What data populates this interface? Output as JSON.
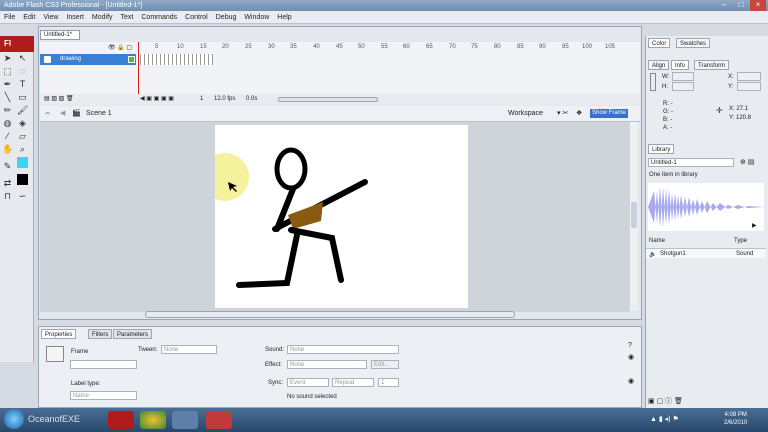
{
  "window": {
    "title": "Adobe Flash CS3 Professional - [Untitled-1*]"
  },
  "menu": [
    "File",
    "Edit",
    "View",
    "Insert",
    "Modify",
    "Text",
    "Commands",
    "Control",
    "Debug",
    "Window",
    "Help"
  ],
  "doc": {
    "tab": "Untitled-1*"
  },
  "timeline": {
    "layer": "drawing",
    "frame_numbers": [
      "5",
      "10",
      "15",
      "20",
      "25",
      "30",
      "35",
      "40",
      "45",
      "50",
      "55",
      "60",
      "65",
      "70",
      "75",
      "80",
      "85",
      "90",
      "95",
      "100",
      "105"
    ],
    "current_frame": "1",
    "fps": "12.0 fps",
    "time": "0.0s"
  },
  "scene": {
    "name": "Scene 1",
    "workspace": "Workspace",
    "show_frame": "Show Frame"
  },
  "properties": {
    "tabs": [
      "Properties",
      "Filters",
      "Parameters"
    ],
    "frame_label": "Frame",
    "tween_label": "Tween:",
    "tween_value": "None",
    "sound_label": "Sound:",
    "sound_value": "None",
    "effect_label": "Effect:",
    "effect_value": "None",
    "edit_button": "Edit...",
    "sync_label": "Sync:",
    "sync_value": "Event",
    "repeat_value": "Repeat",
    "repeat_count": "1",
    "no_sound": "No sound selected",
    "label_type": "Label type:",
    "name_value": "Name"
  },
  "right": {
    "color_tabs": [
      "Color",
      "Swatches"
    ],
    "info_tabs": [
      "Align",
      "Info",
      "Transform"
    ],
    "w": "W:",
    "h": "H:",
    "x": "X:",
    "y": "Y:",
    "r": "R: -",
    "g": "G: -",
    "b": "B: -",
    "a": "A: -",
    "cx": "X: 27.1",
    "cy": "Y: 120.8",
    "library_tab": "Library",
    "library_doc": "Untitled-1",
    "library_count": "One item in library",
    "col_name": "Name",
    "col_type": "Type",
    "item_name": "Shotgun1",
    "item_type": "Sound"
  },
  "taskbar": {
    "time": "4:08 PM",
    "date": "2/6/2010",
    "watermark": "OceanofEXE"
  }
}
